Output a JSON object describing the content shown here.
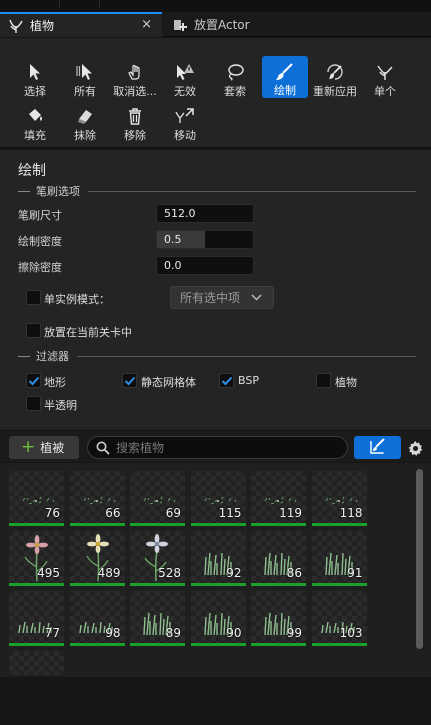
{
  "tabs": [
    {
      "label": "植物",
      "active": true,
      "close": "×"
    },
    {
      "label": "放置Actor",
      "active": false
    }
  ],
  "toolbar": {
    "row1": [
      {
        "label": "选择",
        "icon": "cursor-icon"
      },
      {
        "label": "所有",
        "icon": "select-all-icon"
      },
      {
        "label": "取消选...",
        "icon": "deselect-hand-icon"
      },
      {
        "label": "无效",
        "icon": "invalid-warning-icon"
      },
      {
        "label": "套索",
        "icon": "lasso-icon"
      },
      {
        "label": "绘制",
        "icon": "paint-brush-icon",
        "active": true
      },
      {
        "label": "重新应用",
        "icon": "reapply-brush-icon"
      },
      {
        "label": "单个",
        "icon": "single-plant-icon"
      }
    ],
    "row2": [
      {
        "label": "填充",
        "icon": "fill-bucket-icon"
      },
      {
        "label": "抹除",
        "icon": "eraser-icon"
      },
      {
        "label": "移除",
        "icon": "trash-icon"
      },
      {
        "label": "移动",
        "icon": "move-icon"
      }
    ]
  },
  "details": {
    "section_title": "绘制",
    "brush_group": "笔刷选项",
    "brush_size_label": "笔刷尺寸",
    "brush_size": "512.0",
    "paint_density_label": "绘制密度",
    "paint_density": "0.5",
    "paint_density_fraction": 0.5,
    "erase_density_label": "擦除密度",
    "erase_density": "0.0",
    "single_instance_label": "单实例模式：",
    "single_instance_checked": false,
    "single_instance_option": "所有选中项",
    "place_in_level_label": "放置在当前关卡中",
    "place_in_level_checked": false,
    "filter_group": "过滤器",
    "filters": [
      {
        "label": "地形",
        "checked": true
      },
      {
        "label": "静态网格体",
        "checked": true
      },
      {
        "label": "BSP",
        "checked": true
      },
      {
        "label": "植物",
        "checked": false
      },
      {
        "label": "半透明",
        "checked": false
      }
    ]
  },
  "filterbar": {
    "add_label": "植被",
    "search_placeholder": "搜索植物"
  },
  "foliage": [
    {
      "count": "76",
      "kind": "sparse"
    },
    {
      "count": "66",
      "kind": "sparse"
    },
    {
      "count": "69",
      "kind": "sparse"
    },
    {
      "count": "115",
      "kind": "sparse"
    },
    {
      "count": "119",
      "kind": "sparse"
    },
    {
      "count": "118",
      "kind": "sparse"
    },
    {
      "count": "495",
      "kind": "flower-pink"
    },
    {
      "count": "489",
      "kind": "flower-yellow"
    },
    {
      "count": "528",
      "kind": "flower-white"
    },
    {
      "count": "92",
      "kind": "grass"
    },
    {
      "count": "86",
      "kind": "grass"
    },
    {
      "count": "91",
      "kind": "grass"
    },
    {
      "count": "77",
      "kind": "grass-low"
    },
    {
      "count": "98",
      "kind": "grass-low"
    },
    {
      "count": "89",
      "kind": "grass"
    },
    {
      "count": "90",
      "kind": "grass"
    },
    {
      "count": "99",
      "kind": "grass"
    },
    {
      "count": "103",
      "kind": "grass-low"
    }
  ],
  "colors": {
    "accent": "#0d6fd8",
    "tab_accent": "#1a8fff",
    "foliage_active_bar": "#19a12b",
    "add_plus": "#6fc240"
  }
}
